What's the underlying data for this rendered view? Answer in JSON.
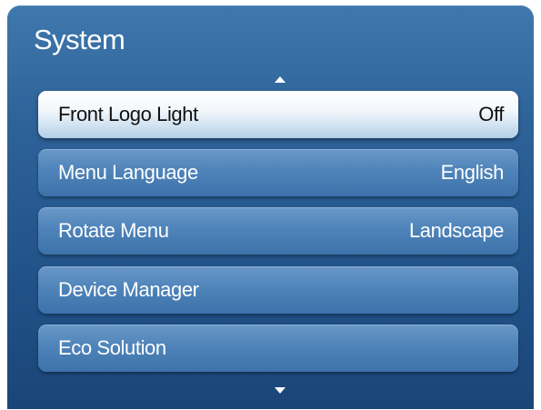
{
  "menu": {
    "title": "System",
    "items": [
      {
        "label": "Front Logo Light",
        "value": "Off",
        "selected": true
      },
      {
        "label": "Menu Language",
        "value": "English",
        "selected": false
      },
      {
        "label": "Rotate Menu",
        "value": "Landscape",
        "selected": false
      },
      {
        "label": "Device Manager",
        "value": "",
        "selected": false
      },
      {
        "label": "Eco Solution",
        "value": "",
        "selected": false
      }
    ]
  },
  "icons": {
    "scroll_up": "triangle-up-icon",
    "scroll_down": "triangle-down-icon"
  },
  "colors": {
    "panel_background": "#2d6299",
    "item_background": "#4f84ba",
    "selected_item_background": "#f4f8fc",
    "text": "#ffffff",
    "selected_text": "#111111"
  }
}
